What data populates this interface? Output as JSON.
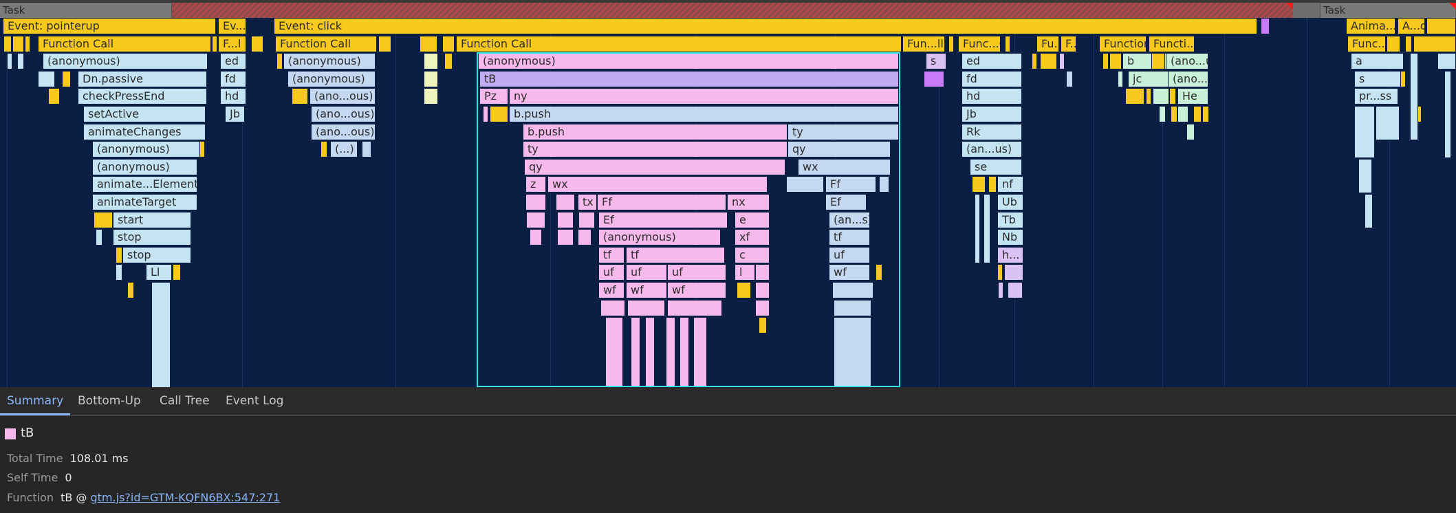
{
  "colors": {
    "background": "#0b1f45",
    "scripting": "#f8c91d",
    "selection_outline": "#2ee8e8",
    "link": "#8ab4f8",
    "tab_active": "#8ab4f8"
  },
  "tasks": [
    {
      "label": "Task",
      "kind": "task"
    },
    {
      "label": "Task",
      "kind": "task"
    }
  ],
  "flame": {
    "events": [
      {
        "label": "Event: pointerup"
      },
      {
        "label": "Ev...up"
      },
      {
        "label": "Event: click"
      },
      {
        "label": "Anima...ired"
      },
      {
        "label": "A...d"
      }
    ],
    "function_calls": [
      "Function Call",
      "F...l",
      "Function Call",
      "Function Call",
      "Fun...ll",
      "Func...Call",
      "Fu...ll",
      "F...",
      "Function Call",
      "Functi... Call",
      "Func...all"
    ],
    "frames": {
      "pointerup": [
        "(anonymous)",
        "Dn.passive",
        "checkPressEnd",
        "setActive",
        "animateChanges",
        "(anonymous)",
        "(anonymous)",
        "animate...Element",
        "animateTarget",
        "start",
        "stop",
        "stop",
        "Ll"
      ],
      "evup": [
        "ed",
        "fd",
        "hd",
        "Jb"
      ],
      "click_left": [
        "(anonymous)",
        "(anonymous)",
        "(ano...ous)",
        "(ano...ous)",
        "(ano...ous)",
        "(...)"
      ],
      "selected_stack": [
        "(anonymous)",
        "tB",
        "Pz",
        "ny",
        "b.push",
        "b.push",
        "ty",
        "ty",
        "qy",
        "qy",
        "z",
        "wx",
        "wx",
        "tx",
        "Ff",
        "nx",
        "Ff",
        "Ef",
        "e",
        "Ef",
        "(anonymous)",
        "xf",
        "(an...s)",
        "tf",
        "tf",
        "c",
        "tf",
        "uf",
        "uf",
        "uf",
        "l",
        "uf",
        "wf",
        "wf",
        "wf",
        "wf"
      ],
      "s_block": [
        "s"
      ],
      "func_call_b": [
        "ed",
        "fd",
        "hd",
        "Jb",
        "Rk",
        "(an...us)",
        "se",
        "nf",
        "Ub",
        "Tb",
        "Nb",
        "h..."
      ],
      "func_call_c": [
        "b",
        "jc"
      ],
      "func_call_d": [
        "(ano...us)",
        "(ano...us)",
        "He"
      ],
      "anim": [
        "a",
        "s",
        "pr...ss"
      ]
    }
  },
  "panel": {
    "tabs": [
      {
        "label": "Summary",
        "active": true
      },
      {
        "label": "Bottom-Up",
        "active": false
      },
      {
        "label": "Call Tree",
        "active": false
      },
      {
        "label": "Event Log",
        "active": false
      }
    ],
    "selected": {
      "name": "tB",
      "swatch_color": "#f7b8ec",
      "total_time_label": "Total Time",
      "total_time": "108.01 ms",
      "self_time_label": "Self Time",
      "self_time": "0",
      "function_label": "Function",
      "function_name": "tB @",
      "function_link": "gtm.js?id=GTM-KQFN6BX:547:271"
    }
  }
}
